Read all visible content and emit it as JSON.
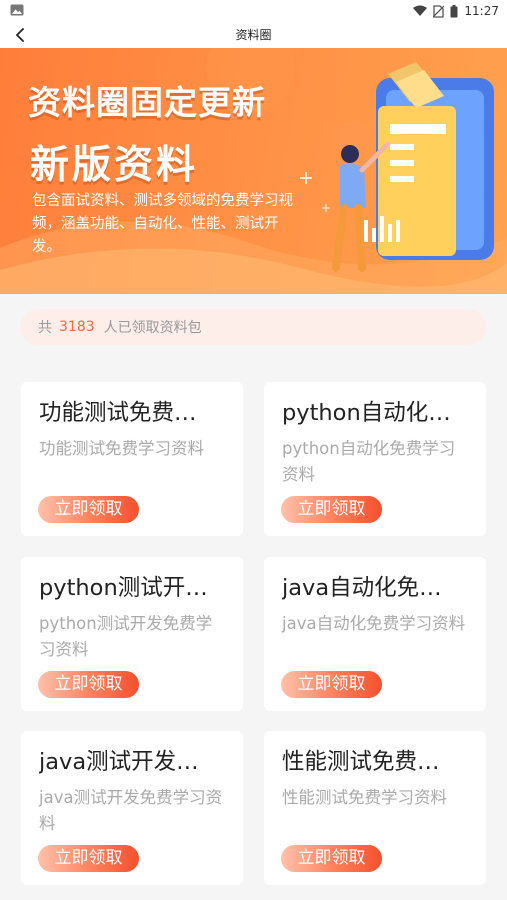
{
  "status_bar": {
    "time": "11:27"
  },
  "nav": {
    "title": "资料圈"
  },
  "banner": {
    "title_line1": "资料圈固定更新",
    "title_line2": "新版资料",
    "description": "包含面试资料、测试多领域的免费学习视频，涵盖功能、自动化、性能、测试开发。"
  },
  "count_bar": {
    "prefix": "共",
    "count": "3183",
    "suffix": "人已领取资料包"
  },
  "cards": [
    {
      "title": "功能测试免费…",
      "subtitle": "功能测试免费学习资料",
      "button": "立即领取"
    },
    {
      "title": "python自动化…",
      "subtitle": "python自动化免费学习资料",
      "button": "立即领取"
    },
    {
      "title": "python测试开…",
      "subtitle": "python测试开发免费学习资料",
      "button": "立即领取"
    },
    {
      "title": "java自动化免…",
      "subtitle": "java自动化免费学习资料",
      "button": "立即领取"
    },
    {
      "title": "java测试开发…",
      "subtitle": "java测试开发免费学习资料",
      "button": "立即领取"
    },
    {
      "title": "性能测试免费…",
      "subtitle": "性能测试免费学习资料",
      "button": "立即领取"
    }
  ],
  "colors": {
    "accent": "#f26b3d",
    "banner_start": "#ff7d3a",
    "banner_end": "#ffa24e"
  }
}
